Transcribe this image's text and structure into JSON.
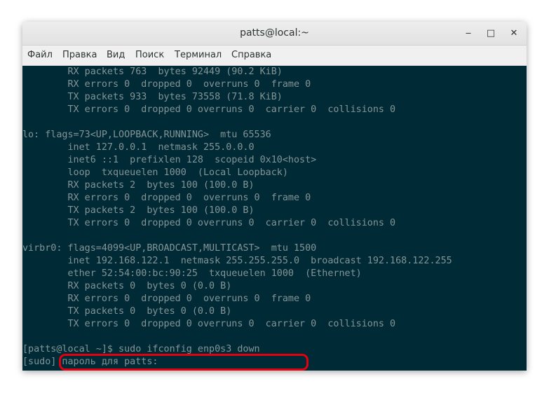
{
  "window": {
    "title": "patts@local:~",
    "buttons": {
      "minimize": "‒",
      "maximize": "□",
      "close": "✕"
    }
  },
  "menu": [
    "Файл",
    "Правка",
    "Вид",
    "Поиск",
    "Терминал",
    "Справка"
  ],
  "terminal": {
    "lines": [
      "        RX packets 763  bytes 92449 (90.2 KiB)",
      "        RX errors 0  dropped 0  overruns 0  frame 0",
      "        TX packets 933  bytes 73558 (71.8 KiB)",
      "        TX errors 0  dropped 0 overruns 0  carrier 0  collisions 0",
      "",
      "lo: flags=73<UP,LOOPBACK,RUNNING>  mtu 65536",
      "        inet 127.0.0.1  netmask 255.0.0.0",
      "        inet6 ::1  prefixlen 128  scopeid 0x10<host>",
      "        loop  txqueuelen 1000  (Local Loopback)",
      "        RX packets 2  bytes 100 (100.0 B)",
      "        RX errors 0  dropped 0  overruns 0  frame 0",
      "        TX packets 2  bytes 100 (100.0 B)",
      "        TX errors 0  dropped 0 overruns 0  carrier 0  collisions 0",
      "",
      "virbr0: flags=4099<UP,BROADCAST,MULTICAST>  mtu 1500",
      "        inet 192.168.122.1  netmask 255.255.255.0  broadcast 192.168.122.255",
      "        ether 52:54:00:bc:90:25  txqueuelen 1000  (Ethernet)",
      "        RX packets 0  bytes 0 (0.0 B)",
      "        RX errors 0  dropped 0  overruns 0  frame 0",
      "        TX packets 0  bytes 0 (0.0 B)",
      "        TX errors 0  dropped 0 overruns 0  carrier 0  collisions 0",
      "",
      "[patts@local ~]$ sudo ifconfig enp0s3 down",
      "[sudo] пароль для patts: "
    ],
    "colors": {
      "background": "#002b36",
      "foreground": "#839496"
    }
  },
  "annotation": {
    "color": "#e3000f"
  }
}
